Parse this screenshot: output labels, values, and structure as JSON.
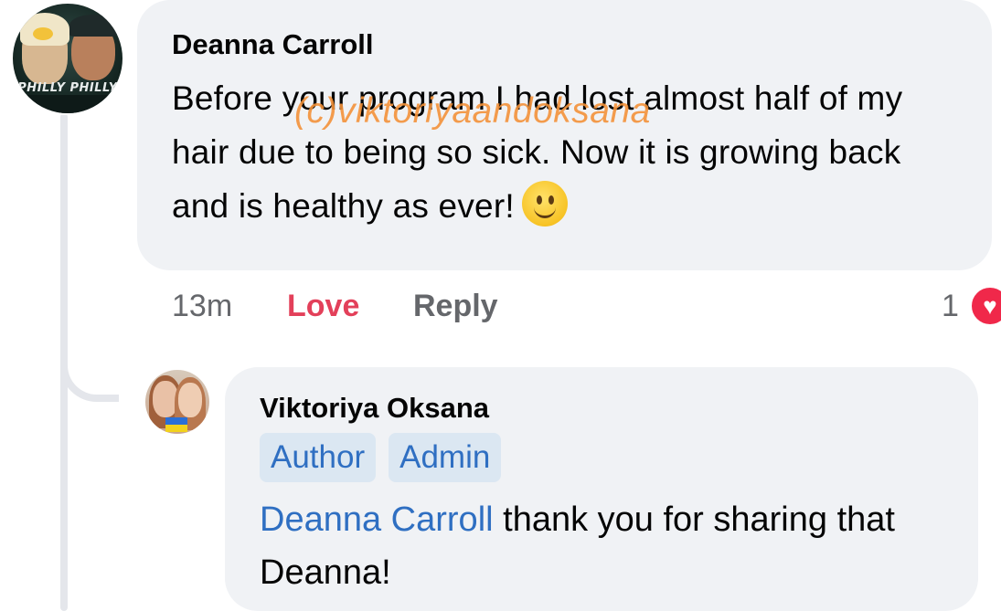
{
  "comment": {
    "author": "Deanna Carroll",
    "avatar_banner": "PHILLY PHILLY",
    "text": "Before your program I had lost almost half of my hair due to being so sick. Now it is growing back and is healthy as ever!",
    "emoji": "slightly-smiling-face-icon",
    "watermark": "(c)viktoriyaandoksana",
    "time": "13m",
    "love_label": "Love",
    "reply_label": "Reply",
    "reaction_count": "1",
    "reaction_icon": "heart-icon"
  },
  "reply": {
    "author": "Viktoriya Oksana",
    "badges": [
      "Author",
      "Admin"
    ],
    "mention": "Deanna Carroll",
    "text": " thank you for sharing that Deanna!"
  },
  "colors": {
    "bubble": "#f0f2f5",
    "love": "#e3405a",
    "link": "#2f6fc2",
    "badge_bg": "#dbe7f2",
    "watermark": "#f4923a",
    "muted": "#65676b"
  }
}
